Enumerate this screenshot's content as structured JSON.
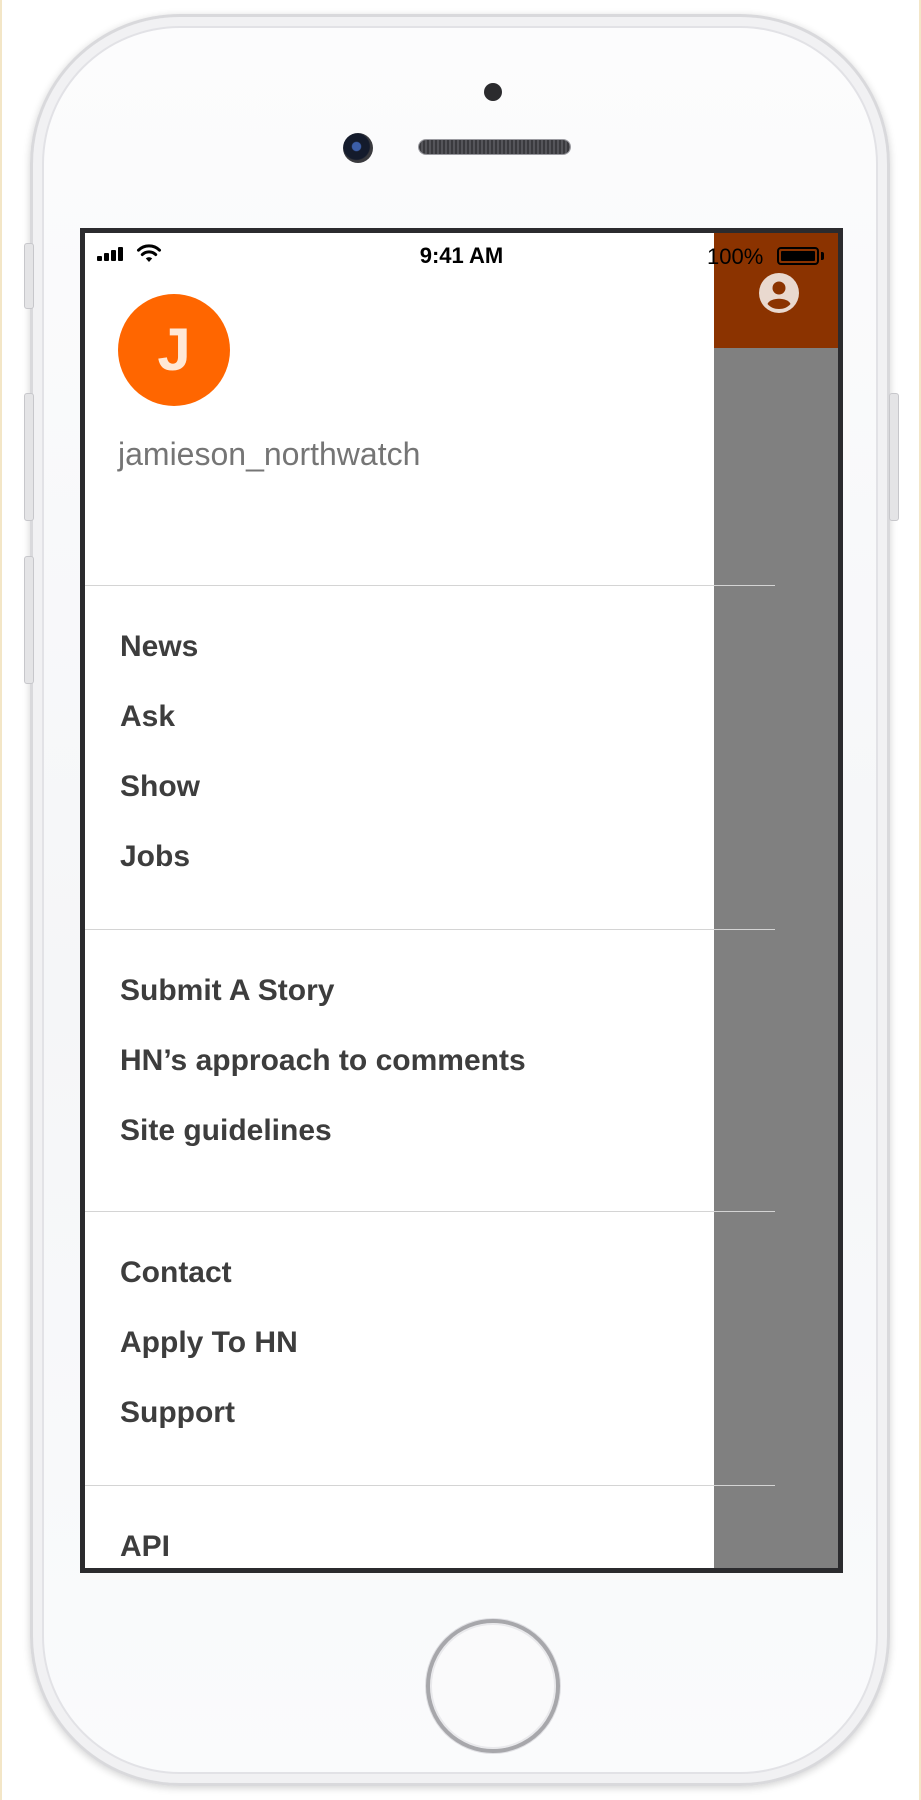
{
  "status_bar": {
    "time": "9:41 AM",
    "battery_percent": "100%",
    "signal_icon": "cellular-signal-icon",
    "wifi_icon": "wifi-icon",
    "battery_icon": "battery-icon"
  },
  "app_bar": {
    "color": "#8b3300",
    "account_icon": "account-circle-icon"
  },
  "overlay_color": "#808080",
  "drawer": {
    "avatar_letter": "J",
    "avatar_color": "#ff6600",
    "username": "jamieson_northwatch",
    "sections": [
      {
        "items": [
          "News",
          "Ask",
          "Show",
          "Jobs"
        ]
      },
      {
        "items": [
          "Submit A Story",
          "HN’s approach to comments",
          "Site guidelines"
        ]
      },
      {
        "items": [
          "Contact",
          "Apply To HN",
          "Support"
        ]
      },
      {
        "items": [
          "API"
        ]
      }
    ]
  }
}
